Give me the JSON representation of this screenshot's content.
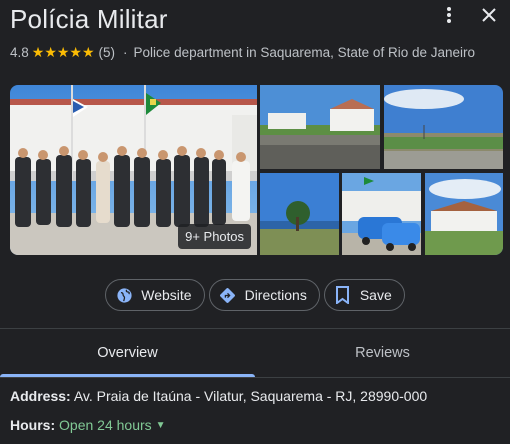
{
  "place": {
    "title": "Polícia Militar",
    "rating": "4.8",
    "stars": "★★★★★",
    "review_count": "(5)",
    "separator": "·",
    "category": "Police department in Saquarema, State of Rio de Janeiro"
  },
  "photos": {
    "count_label": "9+ Photos"
  },
  "actions": [
    {
      "label": "Website",
      "icon": "globe-icon"
    },
    {
      "label": "Directions",
      "icon": "directions-icon"
    },
    {
      "label": "Save",
      "icon": "bookmark-icon"
    }
  ],
  "tabs": [
    {
      "label": "Overview",
      "active": true
    },
    {
      "label": "Reviews",
      "active": false
    }
  ],
  "details": {
    "address_label": "Address:",
    "address_value": "Av. Praia de Itaúna - Vilatur, Saquarema - RJ, 28990-000",
    "hours_label": "Hours:",
    "hours_value": "Open 24 hours"
  },
  "colors": {
    "background": "#202124",
    "accent": "#8ab4f8",
    "open": "#81c995",
    "star": "#fbbc04"
  }
}
